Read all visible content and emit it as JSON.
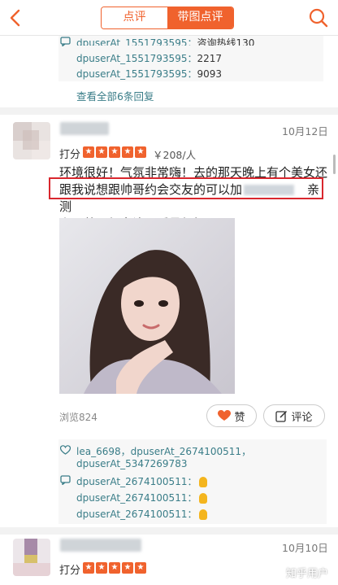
{
  "header": {
    "tab_reviews": "点评",
    "tab_photo_reviews": "带图点评",
    "active_tab": "带图点评"
  },
  "prev_review": {
    "replies": [
      {
        "user": "dpuserAt_1551793595",
        "text": "咨询热线130"
      },
      {
        "user": "dpuserAt_1551793595",
        "text": "2217"
      },
      {
        "user": "dpuserAt_1551793595",
        "text": "9093"
      }
    ],
    "view_all": "查看全部6条回复"
  },
  "review": {
    "date": "10月12日",
    "rating_label": "打分",
    "stars": 5,
    "price": "￥208/人",
    "text_line1": "环境很好！气氛非常嗨！去的那天晚上有个美女还",
    "text_line2_a": "跟我说想跟帅哥约会交友的可以加",
    "text_line2_b": "亲测",
    "text_line3": "上面帅哥很多诶！质量很好！",
    "views": "浏览824",
    "like_label": "赞",
    "comment_label": "评论",
    "likes_line1": "lea_6698，dpuserAt_2674100511，",
    "likes_line2": "dpuserAt_5347269783",
    "comments": [
      {
        "user": "dpuserAt_2674100511",
        "text": "："
      },
      {
        "user": "dpuserAt_2674100511",
        "text": "："
      },
      {
        "user": "dpuserAt_2674100511",
        "text": "："
      }
    ]
  },
  "next_review": {
    "date": "10月10日",
    "rating_label": "打分",
    "stars": 5
  },
  "watermark": "知乎用户",
  "colors": {
    "accent": "#f0622d",
    "link": "#3a7d88",
    "highlight": "#d9272e"
  }
}
